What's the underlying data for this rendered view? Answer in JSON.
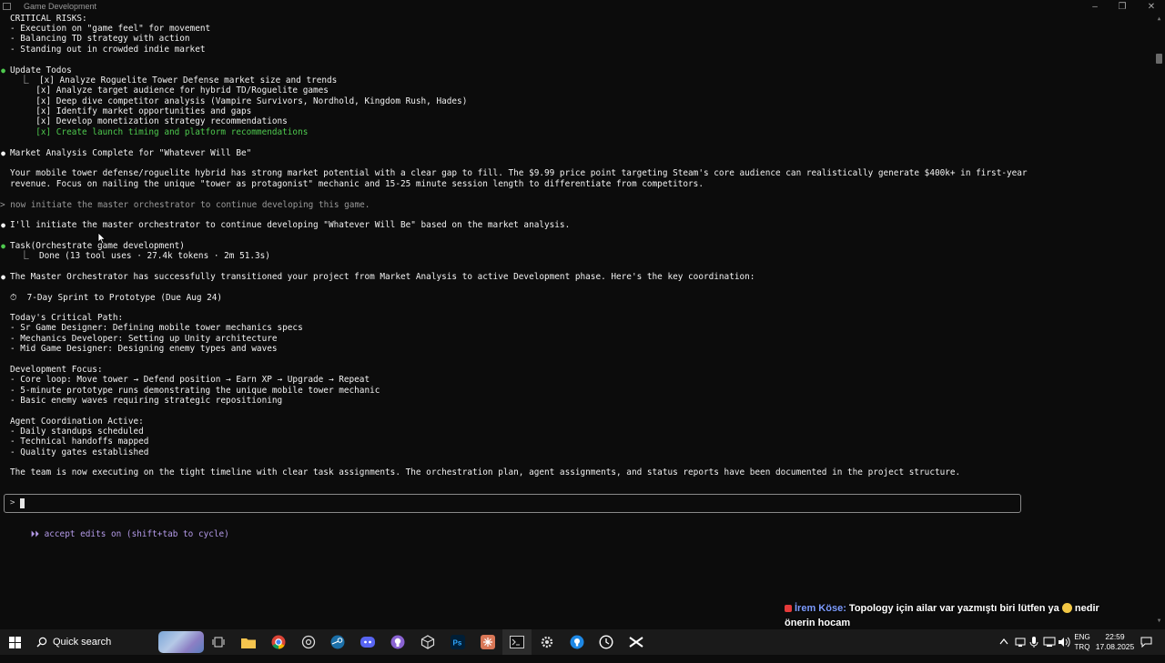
{
  "window": {
    "title": "Game Development"
  },
  "terminal": {
    "lines": [
      {
        "text": "CRITICAL RISKS:"
      },
      {
        "text": "- Execution on \"game feel\" for movement"
      },
      {
        "text": "- Balancing TD strategy with action"
      },
      {
        "text": "- Standing out in crowded indie market"
      },
      {
        "text": "Update Todos"
      },
      {
        "text": "  ⎿  [x] Analyze Roguelite Tower Defense market size and trends"
      },
      {
        "text": "     [x] Analyze target audience for hybrid TD/Roguelite games"
      },
      {
        "text": "     [x] Deep dive competitor analysis (Vampire Survivors, Nordhold, Kingdom Rush, Hades)"
      },
      {
        "text": "     [x] Identify market opportunities and gaps"
      },
      {
        "text": "     [x] Develop monetization strategy recommendations"
      },
      {
        "text": "     [x] Create launch timing and platform recommendations"
      },
      {
        "text": "Market Analysis Complete for \"Whatever Will Be\""
      },
      {
        "text": "Your mobile tower defense/roguelite hybrid has strong market potential with a clear gap to fill. The $9.99 price point targeting Steam's core audience can realistically generate $400k+ in first-year"
      },
      {
        "text": "revenue. Focus on nailing the unique \"tower as protagonist\" mechanic and 15-25 minute session length to differentiate from competitors."
      },
      {
        "text": "> now initiate the master orchestrator to continue developing this game."
      },
      {
        "text": "I'll initiate the master orchestrator to continue developing \"Whatever Will Be\" based on the market analysis."
      },
      {
        "text": "Task(Orchestrate game development)"
      },
      {
        "text": "  ⎿  Done (13 tool uses · 27.4k tokens · 2m 51.3s)"
      },
      {
        "text": "The Master Orchestrator has successfully transitioned your project from Market Analysis to active Development phase. Here's the key coordination:"
      },
      {
        "text": "⏱  7-Day Sprint to Prototype (Due Aug 24)"
      },
      {
        "text": "Today's Critical Path:"
      },
      {
        "text": "- Sr Game Designer: Defining mobile tower mechanics specs"
      },
      {
        "text": "- Mechanics Developer: Setting up Unity architecture"
      },
      {
        "text": "- Mid Game Designer: Designing enemy types and waves"
      },
      {
        "text": "Development Focus:"
      },
      {
        "text": "- Core loop: Move tower → Defend position → Earn XP → Upgrade → Repeat"
      },
      {
        "text": "- 5-minute prototype runs demonstrating the unique mobile tower mechanic"
      },
      {
        "text": "- Basic enemy waves requiring strategic repositioning"
      },
      {
        "text": "Agent Coordination Active:"
      },
      {
        "text": "- Daily standups scheduled"
      },
      {
        "text": "- Technical handoffs mapped"
      },
      {
        "text": "- Quality gates established"
      },
      {
        "text": "The team is now executing on the tight timeline with clear task assignments. The orchestration plan, agent assignments, and status reports have been documented in the project structure."
      }
    ],
    "prompt_symbol": ">",
    "bullet_symbol": "●",
    "mode_hint_icon": "⏵⏵",
    "mode_hint": "accept edits on (shift+tab to cycle)"
  },
  "chat_overlay": {
    "username": "İrem Köse:",
    "message": "Topology için ailar var yazmıştı biri lütfen ya",
    "message_end": "nedir önerin hocam"
  },
  "taskbar": {
    "search_label": "Quick search",
    "lang_top": "ENG",
    "lang_bottom": "TRQ",
    "time": "22:59",
    "date": "17.08.2025"
  },
  "colors": {
    "terminal_bg": "#0c0c0c",
    "bullet_green": "#4ec94e",
    "mode_hint": "#b49ae8",
    "taskbar_bg": "#1a1a1a"
  }
}
